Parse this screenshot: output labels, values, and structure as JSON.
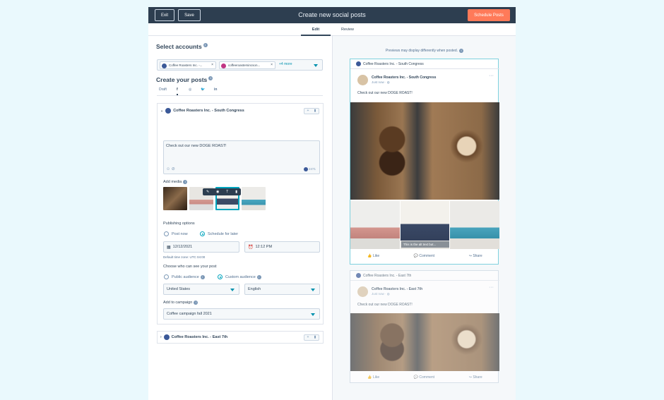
{
  "topbar": {
    "exit_label": "Exit",
    "save_label": "Save",
    "title": "Create new social posts",
    "schedule_label": "Schedule Posts"
  },
  "tabs": [
    {
      "label": "Edit",
      "active": true
    },
    {
      "label": "Review",
      "active": false
    }
  ],
  "select_accounts": {
    "heading": "Select accounts",
    "chips": [
      {
        "label": "Coffee Roasters Inc. -...",
        "network": "facebook"
      },
      {
        "label": "coffeeroastersincson...",
        "network": "instagram"
      }
    ],
    "more_label": "+4 more"
  },
  "create_posts": {
    "heading": "Create your posts",
    "tabs": [
      "Draft",
      "facebook-icon",
      "instagram-icon",
      "twitter-icon",
      "linkedin-icon"
    ]
  },
  "post_card": {
    "account": "Coffee Roasters Inc. - South Congress",
    "message": "Check out our new DOGE ROAST!",
    "char_count": "2471",
    "add_media_label": "Add media",
    "publishing_label": "Publishing options",
    "post_now_label": "Post now",
    "schedule_later_label": "Schedule for later",
    "date": "12/12/2021",
    "time": "12:12 PM",
    "timezone_note": "Default time zone: UTC 04:00",
    "audience_label": "Choose who can see your post",
    "public_audience_label": "Public audience",
    "custom_audience_label": "Custom audience",
    "country": "United States",
    "language": "English",
    "campaign_label": "Add to campaign",
    "campaign": "Coffee campaign fall 2021"
  },
  "second_card": {
    "account": "Coffee Roasters Inc. - East 7th"
  },
  "preview": {
    "note": "Previews may display differently when posted.",
    "first": {
      "header": "Coffee Roasters Inc. - South Congress",
      "name": "Coffee Roasters Inc. - South Congress",
      "time": "Just now · ◍",
      "text": "Check out our new DOGE ROAST!",
      "caption": "This is the alt text but...",
      "like": "Like",
      "comment": "Comment",
      "share": "Share"
    },
    "second": {
      "header": "Coffee Roasters Inc. - East 7th",
      "name": "Coffee Roasters Inc. - East 7th",
      "time": "Just now · ◍",
      "text": "Check out our new DOGE ROAST!",
      "like": "Like",
      "comment": "Comment",
      "share": "Share"
    }
  },
  "colors": {
    "topbar": "#2d3e50",
    "accent": "#ff7a59",
    "teal": "#00a4bd",
    "facebook": "#3b5998"
  }
}
